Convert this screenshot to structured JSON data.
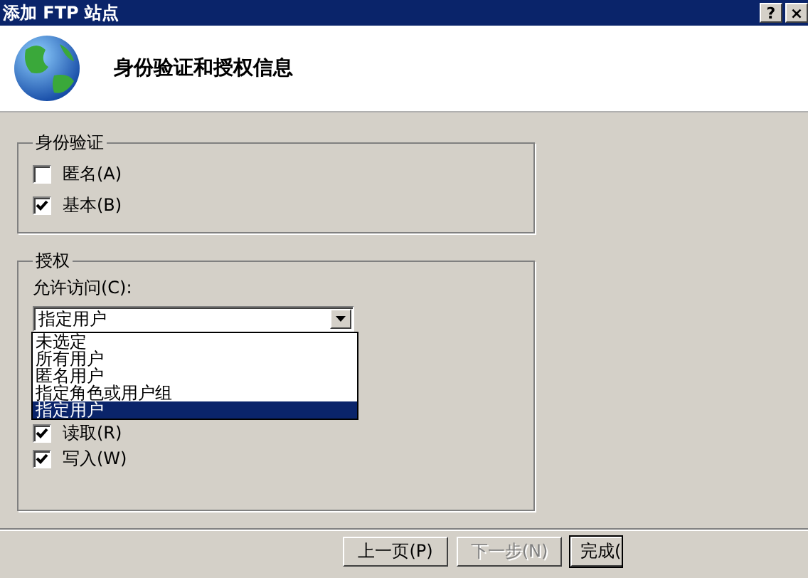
{
  "window": {
    "title": "添加 FTP 站点",
    "controls": [
      "?",
      "×"
    ]
  },
  "header": {
    "title": "身份验证和授权信息"
  },
  "authentication": {
    "legend": "身份验证",
    "options": [
      {
        "label": "匿名(A)",
        "checked": false
      },
      {
        "label": "基本(B)",
        "checked": true
      }
    ]
  },
  "authorization": {
    "legend": "授权",
    "access_label": "允许访问(C):",
    "access_value": "指定用户",
    "dropdown": {
      "expanded": true,
      "items": [
        {
          "label": "未选定",
          "selected": false
        },
        {
          "label": "所有用户",
          "selected": false
        },
        {
          "label": "匿名用户",
          "selected": false
        },
        {
          "label": "指定角色或用户组",
          "selected": false
        },
        {
          "label": "指定用户",
          "selected": true
        }
      ]
    },
    "permissions": [
      {
        "label": "读取(R)",
        "checked": true
      },
      {
        "label": "写入(W)",
        "checked": true
      }
    ]
  },
  "buttons": [
    {
      "label": "上一页(P)",
      "disabled": false
    },
    {
      "label": "下一步(N)",
      "disabled": true
    },
    {
      "label": "完成(",
      "disabled": false
    }
  ]
}
